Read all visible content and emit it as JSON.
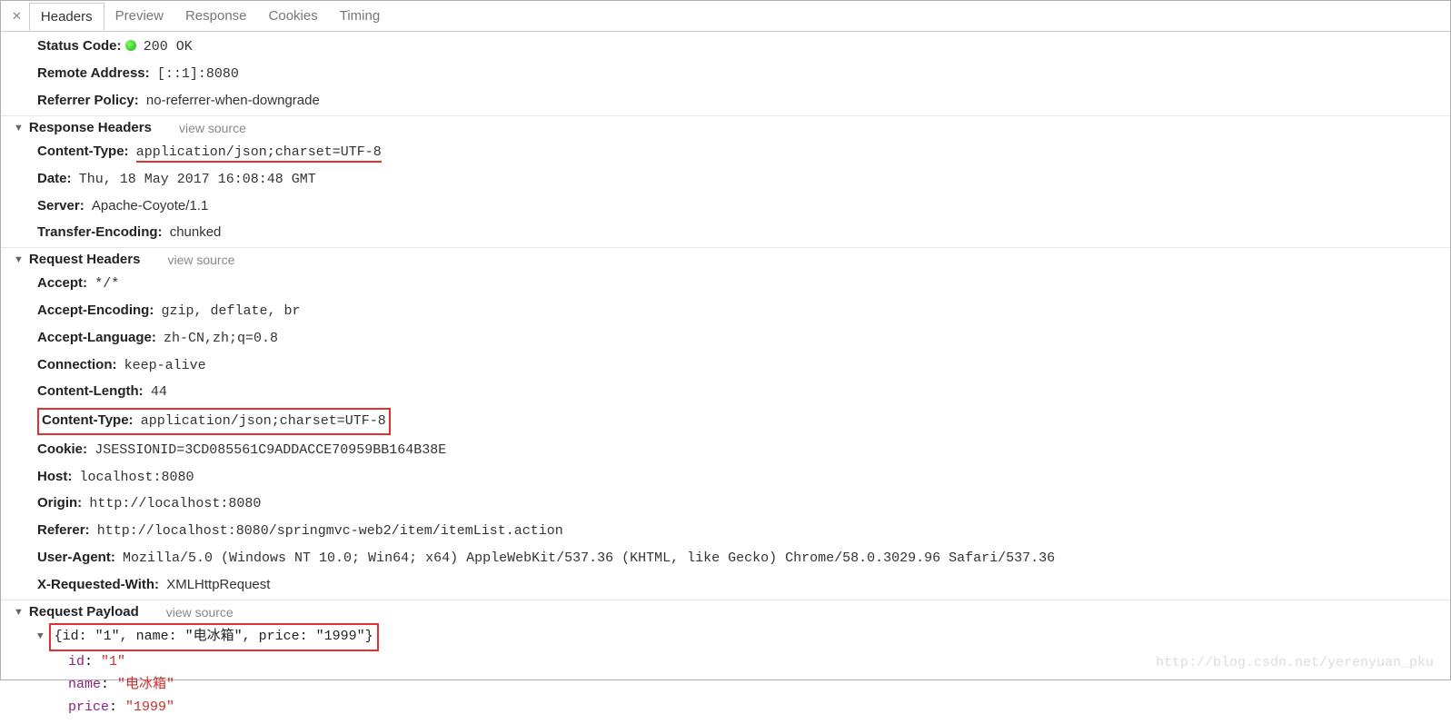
{
  "tabs": {
    "headers": "Headers",
    "preview": "Preview",
    "response": "Response",
    "cookies": "Cookies",
    "timing": "Timing"
  },
  "general": {
    "status_key": "Status Code:",
    "status_val": "200 OK",
    "remote_key": "Remote Address:",
    "remote_val": "[::1]:8080",
    "refpol_key": "Referrer Policy:",
    "refpol_val": "no-referrer-when-downgrade"
  },
  "sections": {
    "response_headers": "Response Headers",
    "request_headers": "Request Headers",
    "request_payload": "Request Payload",
    "view_source": "view source"
  },
  "response_headers": {
    "content_type_key": "Content-Type:",
    "content_type_val": "application/json;charset=UTF-8",
    "date_key": "Date:",
    "date_val": "Thu, 18 May 2017 16:08:48 GMT",
    "server_key": "Server:",
    "server_val": "Apache-Coyote/1.1",
    "transfer_key": "Transfer-Encoding:",
    "transfer_val": "chunked"
  },
  "request_headers": {
    "accept_key": "Accept:",
    "accept_val": "*/*",
    "accenc_key": "Accept-Encoding:",
    "accenc_val": "gzip, deflate, br",
    "acclang_key": "Accept-Language:",
    "acclang_val": "zh-CN,zh;q=0.8",
    "conn_key": "Connection:",
    "conn_val": "keep-alive",
    "contlen_key": "Content-Length:",
    "contlen_val": "44",
    "conttype_key": "Content-Type:",
    "conttype_val": "application/json;charset=UTF-8",
    "cookie_key": "Cookie:",
    "cookie_val": "JSESSIONID=3CD085561C9ADDACCE70959BB164B38E",
    "host_key": "Host:",
    "host_val": "localhost:8080",
    "origin_key": "Origin:",
    "origin_val": "http://localhost:8080",
    "referer_key": "Referer:",
    "referer_val": "http://localhost:8080/springmvc-web2/item/itemList.action",
    "ua_key": "User-Agent:",
    "ua_val": "Mozilla/5.0 (Windows NT 10.0; Win64; x64) AppleWebKit/537.36 (KHTML, like Gecko) Chrome/58.0.3029.96 Safari/537.36",
    "xreq_key": "X-Requested-With:",
    "xreq_val": "XMLHttpRequest"
  },
  "payload": {
    "summary": "{id: \"1\", name: \"电冰箱\", price: \"1999\"}",
    "id_key": "id",
    "id_val": "\"1\"",
    "name_key": "name",
    "name_val": "\"电冰箱\"",
    "price_key": "price",
    "price_val": "\"1999\""
  },
  "watermark": "http://blog.csdn.net/yerenyuan_pku"
}
